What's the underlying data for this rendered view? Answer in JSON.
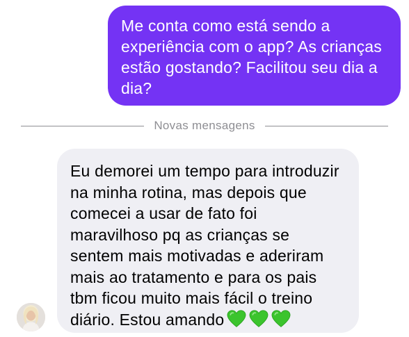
{
  "outgoing_message": {
    "lines": [
      "Me conta como está sendo a",
      "experiência com o app? As crianças",
      "estão gostando? Facilitou seu dia a",
      "dia?"
    ],
    "bubble_color": "#7433f4"
  },
  "divider": {
    "label": "Novas mensagens"
  },
  "incoming_message": {
    "lines": [
      "Eu demorei um tempo para introduzir",
      "na minha rotina, mas depois que",
      "comecei a usar de fato foi",
      "maravilhoso pq as crianças se",
      "sentem mais motivadas e aderiram",
      "mais ao tratamento e para os pais",
      "tbm ficou muito mais fácil o treino",
      "diário. Estou amando"
    ],
    "emoji": [
      "green-heart",
      "green-heart",
      "green-heart"
    ],
    "bubble_color": "#efeff4"
  },
  "avatar": {
    "icon": "user-avatar-photo"
  }
}
